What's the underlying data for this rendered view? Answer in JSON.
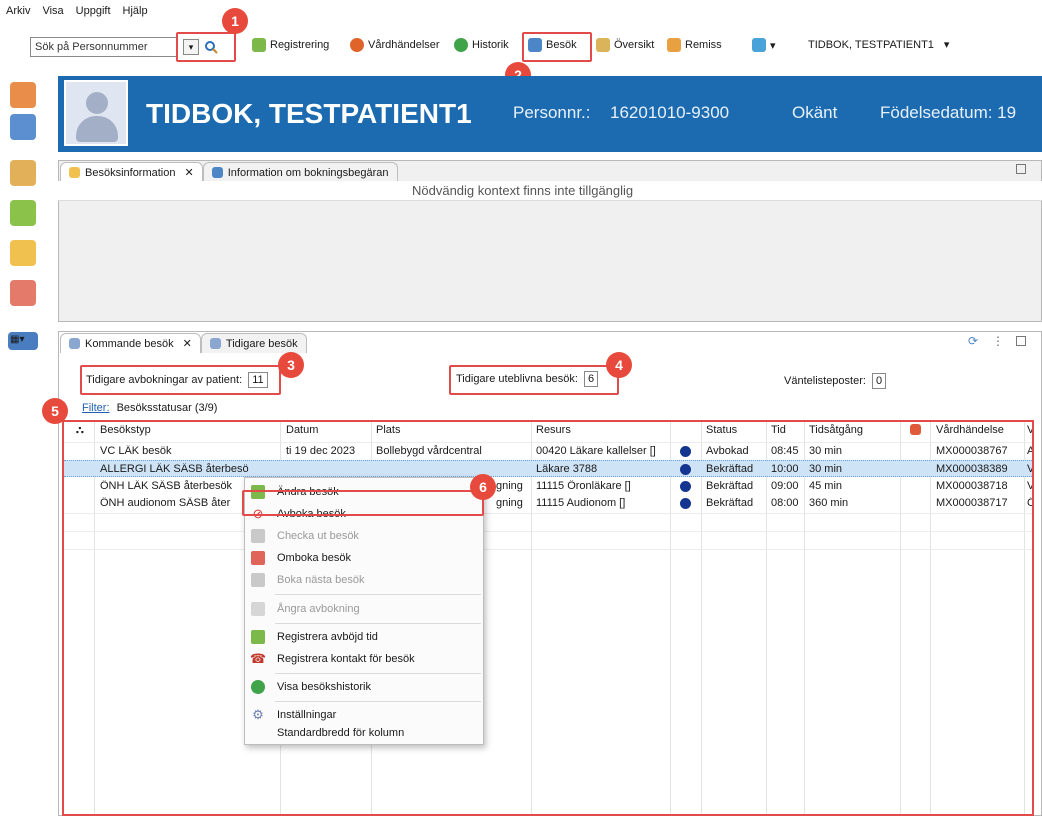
{
  "menu": {
    "items": [
      "Arkiv",
      "Visa",
      "Uppgift",
      "Hjälp"
    ]
  },
  "search": {
    "placeholder": "Sök på Personnummer"
  },
  "toolbar": {
    "registrering": "Registrering",
    "vardhandelser": "Vårdhändelser",
    "historik": "Historik",
    "besok": "Besök",
    "oversikt": "Översikt",
    "remiss": "Remiss",
    "patient_select": "TIDBOK, TESTPATIENT1"
  },
  "badges": [
    "1",
    "2",
    "3",
    "4",
    "5",
    "6"
  ],
  "banner": {
    "name": "TIDBOK, TESTPATIENT1",
    "personnr_label": "Personnr.:",
    "personnr": "16201010-9300",
    "status": "Okänt",
    "birth_label": "Födelsedatum: 19"
  },
  "upper_panel": {
    "tabs": [
      "Besöksinformation",
      "Information om bokningsbegäran"
    ],
    "message": "Nödvändig kontext finns inte tillgänglig"
  },
  "lower_panel": {
    "tabs": [
      "Kommande besök",
      "Tidigare besök"
    ],
    "prev_cancellations_label": "Tidigare avbokningar av patient:",
    "prev_cancellations": "11",
    "prev_noshow_label": "Tidigare uteblivna besök:",
    "prev_noshow": "6",
    "waitlist_label": "Väntelisteposter:",
    "waitlist": "0",
    "filter_label": "Filter:",
    "filter_value": "Besöksstatusar (3/9)"
  },
  "table": {
    "headers": {
      "besokstyp": "Besökstyp",
      "datum": "Datum",
      "plats": "Plats",
      "resurs": "Resurs",
      "status": "Status",
      "tid": "Tid",
      "tidsatgang": "Tidsåtgång",
      "vardhandelse": "Vårdhändelse",
      "extra": "V"
    },
    "rows": [
      {
        "besokstyp": "VC LÄK besök",
        "datum": "ti 19 dec 2023",
        "plats": "Bollebygd vårdcentral",
        "resurs": "00420 Läkare kallelser []",
        "status": "Avbokad",
        "tid": "08:45",
        "tidsatgang": "30 min",
        "vardhandelse": "MX000038767",
        "extra": "A"
      },
      {
        "besokstyp": "ALLERGI LÄK SÄSB återbesö",
        "datum": "",
        "plats": "",
        "resurs": "Läkare 3788",
        "status": "Bekräftad",
        "tid": "10:00",
        "tidsatgang": "30 min",
        "vardhandelse": "MX000038389",
        "extra": "V"
      },
      {
        "besokstyp": "ÖNH LÄK SÄSB återbesök",
        "datum": "",
        "plats": "gning",
        "resurs": "11115 Öronläkare []",
        "status": "Bekräftad",
        "tid": "09:00",
        "tidsatgang": "45 min",
        "vardhandelse": "MX000038718",
        "extra": "V"
      },
      {
        "besokstyp": "ÖNH audionom SÄSB åter",
        "datum": "",
        "plats": "gning",
        "resurs": "11115 Audionom []",
        "status": "Bekräftad",
        "tid": "08:00",
        "tidsatgang": "360 min",
        "vardhandelse": "MX000038717",
        "extra": "Ö"
      }
    ]
  },
  "context_menu": {
    "items": [
      "Ändra besök",
      "Avboka besök",
      "Checka ut besök",
      "Omboka besök",
      "Boka nästa besök",
      "Ångra avbokning",
      "Registrera avböjd tid",
      "Registrera kontakt för besök",
      "Visa besökshistorik",
      "Inställningar",
      "Standardbredd för kolumn"
    ]
  },
  "colors": {
    "banner": "#1c6bb0",
    "highlight": "#e34b4b",
    "badge": "#e74a3c",
    "selected_row": "#cfe3f6",
    "status_dot": "#14358f"
  }
}
